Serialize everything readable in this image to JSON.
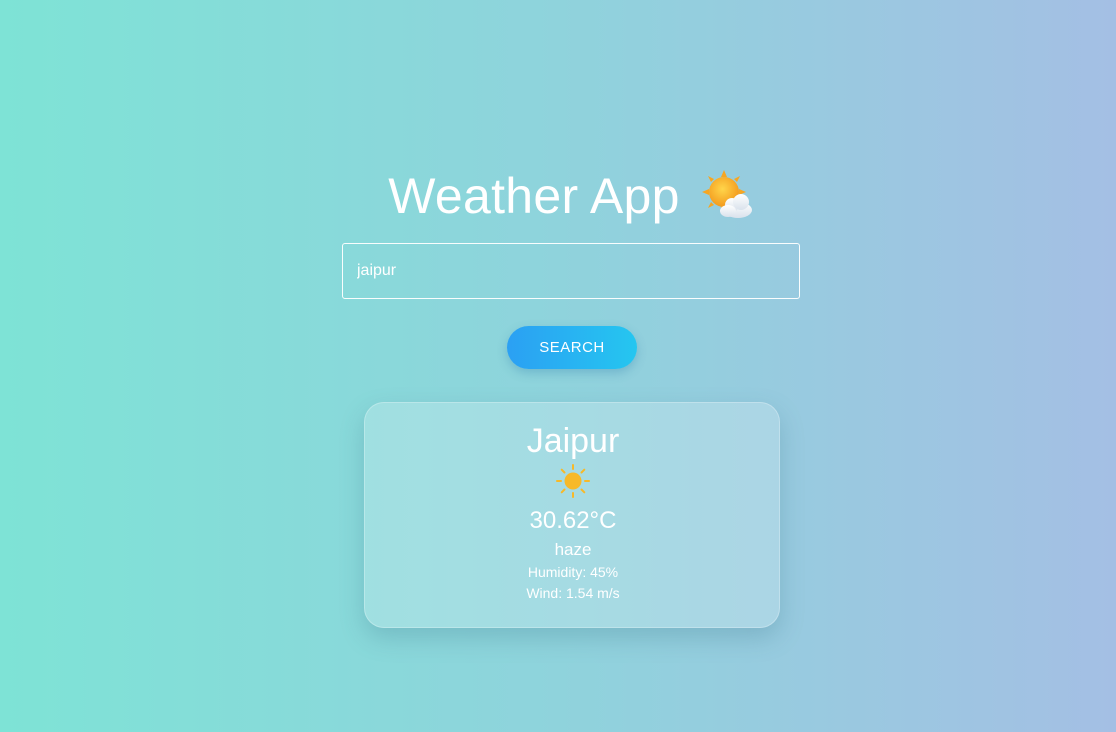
{
  "app": {
    "title": "Weather App",
    "title_icon": "sun-behind-cloud-icon"
  },
  "search": {
    "value": "jaipur",
    "placeholder": "",
    "button_label": "SEARCH"
  },
  "weather": {
    "city": "Jaipur",
    "icon": "sun-icon",
    "temperature": "30.62°C",
    "description": "haze",
    "humidity": "Humidity: 45%",
    "wind": "Wind: 1.54 m/s"
  },
  "colors": {
    "background_start": "#7ee3d6",
    "background_end": "#a4bfe4",
    "button_start": "#2ba0f3",
    "button_end": "#25c6f0",
    "sun": "#f7b928"
  }
}
